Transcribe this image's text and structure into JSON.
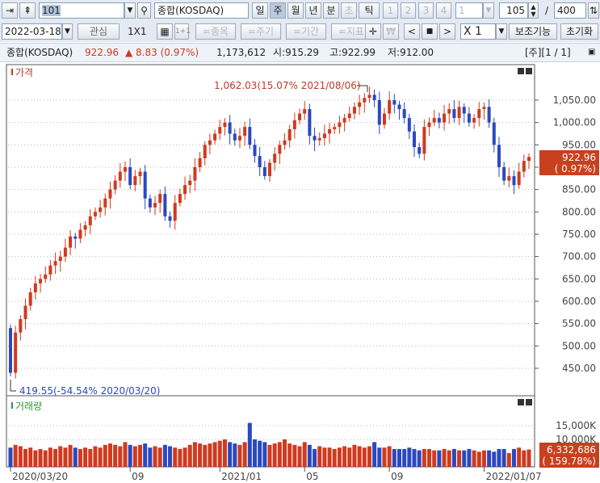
{
  "toolbar": {
    "code": "101",
    "name": "종합(KOSDAQ)",
    "periods": [
      "일",
      "주",
      "월",
      "년",
      "분",
      "초",
      "틱"
    ],
    "nums": [
      "1",
      "2",
      "3",
      "4"
    ],
    "num_select": "1",
    "count": "105",
    "total": "400",
    "slash": "/",
    "date": "2022-03-18",
    "fav": "관심",
    "layout": "1X1",
    "one": "1+1",
    "stock": "=종목",
    "cycle": "=주기",
    "range": "=기간",
    "indicator": "=지표",
    "won": "₩",
    "prev": "<",
    "stop": "■",
    "next": ">",
    "scale": "X 1",
    "aux": "보조기능",
    "reset": "초기화"
  },
  "info": {
    "name": "종합(KOSDAQ)",
    "price": "922.96",
    "change": "▲ 8.83 (0.97%)",
    "volume": "1,173,612",
    "open": "시:915.29",
    "high": "고:922.99",
    "low": "저:912.00",
    "page": "[주][1 / 1]"
  },
  "colors": {
    "up": "#d03a1e",
    "down": "#2a48c0"
  },
  "chart_data": {
    "type": "candlestick",
    "title": "가격",
    "volume_title": "거래량",
    "price_ticks": [
      1050,
      1000,
      950,
      900,
      850,
      800,
      750,
      700,
      650,
      600,
      550,
      500,
      450
    ],
    "price_tick_labels": [
      "1,050.00",
      "1,000.00",
      "950.00",
      "900.00",
      "850.00",
      "800.00",
      "750.00",
      "700.00",
      "650.00",
      "600.00",
      "550.00",
      "500.00",
      "450.00"
    ],
    "ylim": [
      420,
      1080
    ],
    "volume_ticks": [
      15000,
      10000
    ],
    "volume_tick_labels": [
      "15,000K",
      "10,000K"
    ],
    "volume_ylim": [
      0,
      20000
    ],
    "x_labels": [
      {
        "i": 0,
        "t": "2020/03/20"
      },
      {
        "i": 24,
        "t": "09"
      },
      {
        "i": 42,
        "t": "2021/01"
      },
      {
        "i": 59,
        "t": "05"
      },
      {
        "i": 76,
        "t": "09"
      },
      {
        "i": 95,
        "t": "2022/01/07"
      }
    ],
    "high_annotation": "1,062.03(15.07% 2021/08/06)",
    "low_annotation": "419.55(-54.54% 2020/03/20)",
    "last_price": "922.96",
    "last_pct": "( 0.97%)",
    "last_volume": "6,332,686",
    "last_volume_pct": "( 159.78%)",
    "first_open": 540,
    "close": [
      440,
      530,
      560,
      590,
      620,
      640,
      650,
      660,
      680,
      690,
      700,
      720,
      745,
      740,
      760,
      770,
      790,
      800,
      810,
      830,
      850,
      870,
      890,
      900,
      860,
      880,
      890,
      830,
      810,
      820,
      840,
      790,
      780,
      820,
      840,
      860,
      870,
      900,
      920,
      950,
      960,
      975,
      990,
      1000,
      975,
      960,
      970,
      990,
      950,
      925,
      900,
      880,
      910,
      930,
      950,
      960,
      985,
      1005,
      1020,
      1030,
      970,
      960,
      965,
      975,
      985,
      990,
      1000,
      1010,
      1020,
      1035,
      1045,
      1055,
      1062,
      1050,
      995,
      1020,
      1050,
      1040,
      1030,
      1010,
      980,
      945,
      930,
      990,
      1000,
      1010,
      1000,
      1020,
      1030,
      1010,
      1035,
      1020,
      1000,
      1010,
      1030,
      1035,
      1000,
      950,
      900,
      870,
      880,
      860,
      890,
      914,
      923
    ],
    "volume_k": [
      7000,
      8000,
      7500,
      6500,
      7000,
      6000,
      6500,
      6000,
      7000,
      6500,
      7500,
      7000,
      8000,
      7000,
      6500,
      7000,
      6500,
      7500,
      7000,
      8000,
      8500,
      8000,
      7500,
      9000,
      8000,
      7500,
      8000,
      8500,
      7000,
      7500,
      7000,
      8000,
      7500,
      7000,
      6500,
      7000,
      8000,
      9000,
      8500,
      8000,
      8500,
      9000,
      9500,
      10000,
      9000,
      8500,
      8000,
      9000,
      16000,
      10000,
      9500,
      9000,
      8000,
      8500,
      9000,
      10000,
      8500,
      8000,
      7500,
      9000,
      8000,
      6500,
      7500,
      7000,
      7000,
      6500,
      7000,
      7500,
      7000,
      8000,
      7500,
      7000,
      7500,
      9000,
      7000,
      7000,
      7500,
      6500,
      6500,
      6500,
      7000,
      6500,
      6000,
      6500,
      6500,
      6000,
      6000,
      6500,
      6000,
      6500,
      6000,
      6000,
      6500,
      6000,
      5500,
      6000,
      6000,
      5500,
      6500,
      6500,
      5000,
      6500,
      7000,
      6000,
      6300
    ]
  }
}
